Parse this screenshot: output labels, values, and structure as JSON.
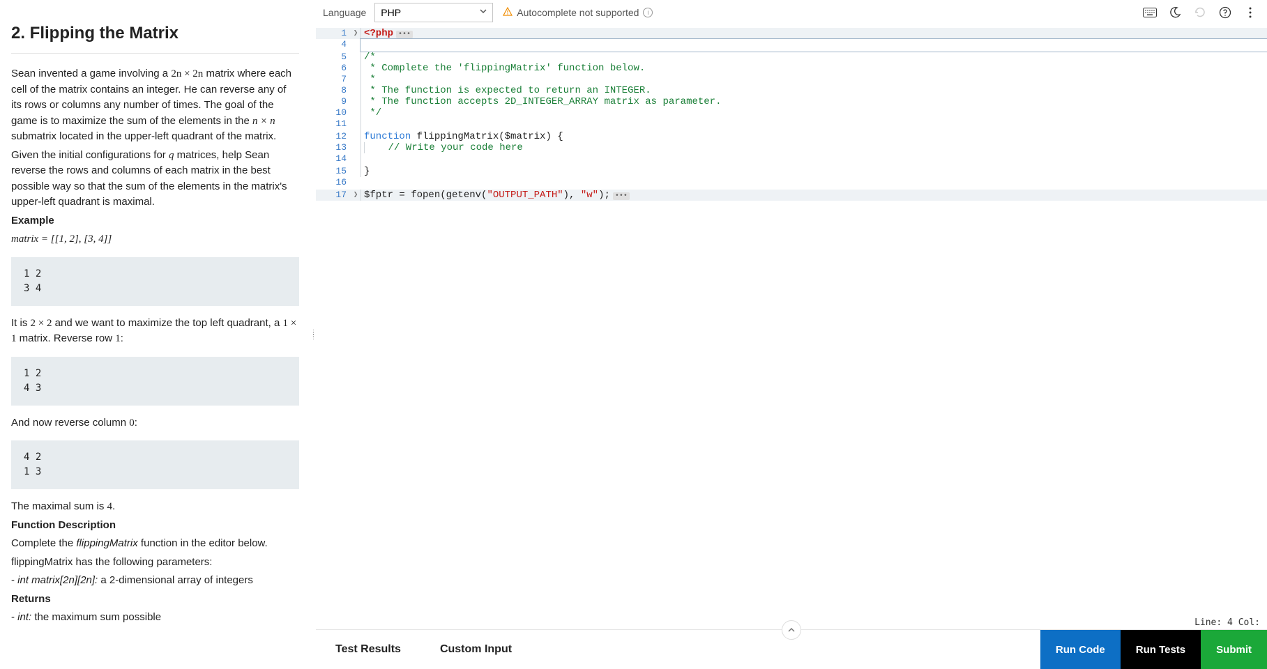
{
  "problem": {
    "title": "2. Flipping the Matrix",
    "intro_pre": "Sean invented a game involving a ",
    "expr_2n": "2n × 2n",
    "intro_mid1": " matrix where each cell of the matrix contains an integer. He can reverse any of its rows or columns any number of times. The goal of the game is to maximize the sum of the elements in the ",
    "expr_nn": "n × n",
    "intro_mid2": " submatrix located in the upper-left quadrant of the matrix.",
    "given_pre": "Given the initial configurations for ",
    "expr_q": "q",
    "given_post": " matrices, help Sean reverse the rows and columns of each matrix in the best possible way so that the sum of the elements in the matrix's upper-left quadrant is maximal.",
    "example_label": "Example",
    "matrix_expr": "matrix = [[1, 2], [3, 4]]",
    "block1": "1 2\n3 4",
    "explain1_pre": "It is ",
    "expr_2x2": "2 × 2",
    "explain1_mid": " and we want to maximize the top left quadrant, a ",
    "expr_1x1": "1 × 1",
    "explain1_post": " matrix. Reverse row ",
    "expr_1": "1",
    "colon": ":",
    "block2": "1 2\n4 3",
    "explain2_pre": "And now reverse column ",
    "expr_0": "0",
    "block3": "4 2\n1 3",
    "maxsum_pre": "The maximal sum is ",
    "expr_4": "4",
    "period": ".",
    "fd_label": "Function Description",
    "fd_text_pre": "Complete the ",
    "fd_fn": "flippingMatrix",
    "fd_text_post": " function in the editor below.",
    "params_intro": "flippingMatrix has the following parameters:",
    "param_sig": "int matrix[2n][2n]:",
    "param_desc": " a 2-dimensional array of integers",
    "returns_label": "Returns",
    "ret_sig": "int:",
    "ret_desc": " the maximum sum possible"
  },
  "toolbar": {
    "language_label": "Language",
    "selected_lang": "PHP",
    "autocomplete_warn": "Autocomplete not supported"
  },
  "code": {
    "l1": "<?php",
    "l5": "/*",
    "l6": " * Complete the 'flippingMatrix' function below.",
    "l7": " *",
    "l8": " * The function is expected to return an INTEGER.",
    "l9": " * The function accepts 2D_INTEGER_ARRAY matrix as parameter.",
    "l10": " */",
    "l12_kw": "function",
    "l12_fn": " flippingMatrix",
    "l12_rest": "($matrix) {",
    "l13": "    // Write your code here",
    "l15": "}",
    "l17_a": "$fptr = fopen(getenv(",
    "l17_s1": "\"OUTPUT_PATH\"",
    "l17_b": "), ",
    "l17_s2": "\"w\"",
    "l17_c": ");"
  },
  "gutter": {
    "n1": "1",
    "n4": "4",
    "n5": "5",
    "n6": "6",
    "n7": "7",
    "n8": "8",
    "n9": "9",
    "n10": "10",
    "n11": "11",
    "n12": "12",
    "n13": "13",
    "n14": "14",
    "n15": "15",
    "n16": "16",
    "n17": "17"
  },
  "status": {
    "text": "Line: 4 Col:"
  },
  "bottom": {
    "tab_results": "Test Results",
    "tab_custom": "Custom Input",
    "run_code": "Run Code",
    "run_tests": "Run Tests",
    "submit": "Submit"
  }
}
